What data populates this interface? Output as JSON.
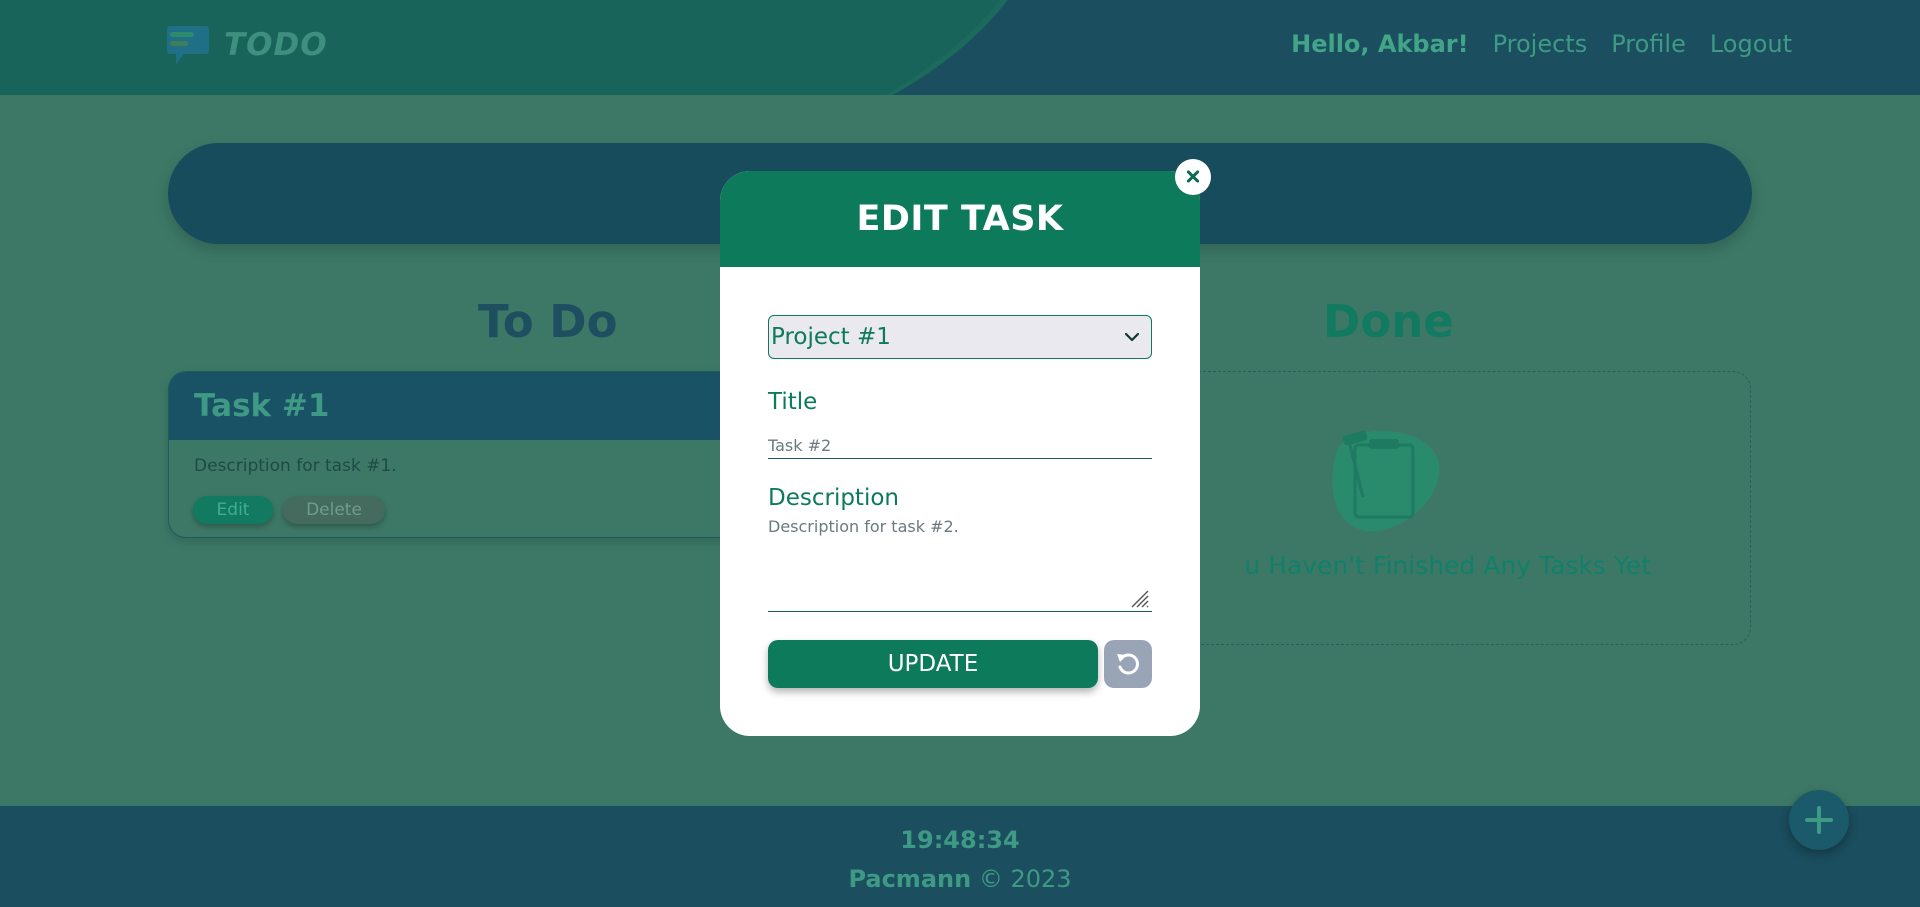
{
  "header": {
    "logo_text": "TODO",
    "nav": {
      "greeting": "Hello, Akbar!",
      "projects": "Projects",
      "profile": "Profile",
      "logout": "Logout"
    }
  },
  "columns": {
    "todo_title": "To Do",
    "done_title": "Done"
  },
  "tasks": [
    {
      "title": "Task #1",
      "description": "Description for task #1.",
      "edit_label": "Edit",
      "delete_label": "Delete"
    }
  ],
  "done": {
    "empty_text": "u Haven't Finished Any Tasks Yet"
  },
  "modal": {
    "title": "EDIT TASK",
    "project_selected": "Project #1",
    "title_label": "Title",
    "title_value": "Task #2",
    "description_label": "Description",
    "description_value": "Description for task #2.",
    "update_label": "UPDATE"
  },
  "footer": {
    "clock": "19:48:34",
    "brand": "Pacmann",
    "copyright": "© 2023"
  },
  "colors": {
    "primary": "#0d7a5c",
    "header_bg": "#1b4e5e",
    "page_bg": "#3d7866"
  }
}
